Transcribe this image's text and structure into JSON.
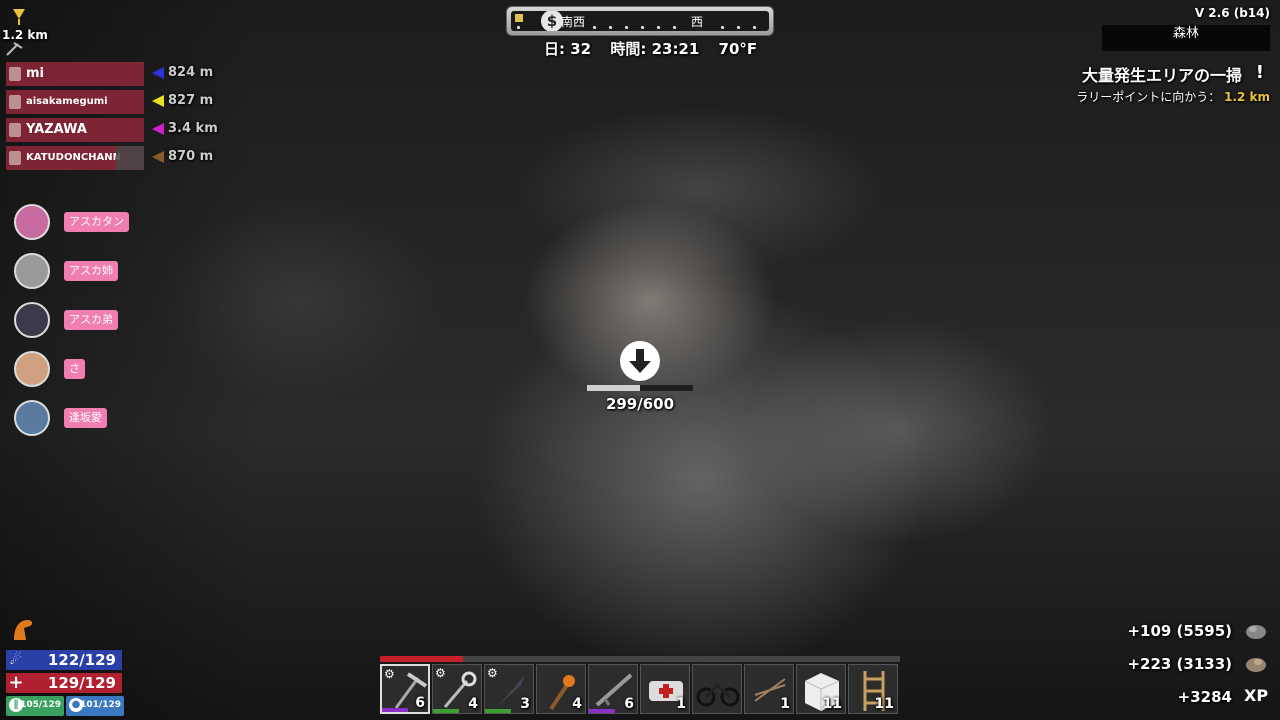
{
  "compass": {
    "labels": [
      "南西",
      "西"
    ],
    "icon": "dollar-icon"
  },
  "time": {
    "day": "日: 32",
    "clock": "時間: 23:21",
    "temp": "70°F"
  },
  "version": "V 2.6 (b14)",
  "biome": "森林",
  "quest": {
    "title": "大量発生エリアの一掃",
    "sub_label": "ラリーポイントに向かう：",
    "sub_dist": "1.2 km"
  },
  "top_left": {
    "distance": "1.2 km"
  },
  "players": [
    {
      "name": "mi",
      "distance": "824 m",
      "color": "#3030e0"
    },
    {
      "name": "aisakamegumi",
      "distance": "827 m",
      "color": "#e8e020"
    },
    {
      "name": "YAZAWA",
      "distance": "3.4 km",
      "color": "#d020d0"
    },
    {
      "name": "KATUDONCHANN",
      "distance": "870 m",
      "color": "#8a5a2a"
    }
  ],
  "party": [
    {
      "tag": "アスカタン",
      "avatar_color": "#c86aa0"
    },
    {
      "tag": "アスカ姉",
      "avatar_color": "#9a9a9a"
    },
    {
      "tag": "アスカ弟",
      "avatar_color": "#3a3a4a"
    },
    {
      "tag": "さ",
      "avatar_color": "#d0a080"
    },
    {
      "tag": "逢坂愛",
      "avatar_color": "#5a7aa0"
    }
  ],
  "target": {
    "hp": "299/600",
    "hp_fraction": 0.498
  },
  "stats": {
    "stamina": "122/129",
    "health": "129/129",
    "food": "105/129",
    "water": "101/129"
  },
  "xp": [
    {
      "text": "+109 (5595)",
      "icon": "stone-icon"
    },
    {
      "text": "+223 (3133)",
      "icon": "ore-icon"
    },
    {
      "text": "+3284",
      "icon": "xp-icon"
    }
  ],
  "toolbelt": {
    "durability_fraction": 0.16,
    "slots": [
      {
        "name": "pickaxe",
        "count": "6",
        "quality_color": "#8a2fc8",
        "mod": true
      },
      {
        "name": "wrench",
        "count": "4",
        "quality_color": "#3aa030",
        "mod": true
      },
      {
        "name": "knife",
        "count": "3",
        "quality_color": "#3aa030",
        "mod": true
      },
      {
        "name": "torch",
        "count": "4",
        "quality_color": "",
        "mod": false
      },
      {
        "name": "rifle",
        "count": "6",
        "quality_color": "#8a2fc8",
        "mod": false
      },
      {
        "name": "medkit",
        "count": "1",
        "quality_color": "",
        "mod": false
      },
      {
        "name": "motorcycle",
        "count": "",
        "quality_color": "",
        "mod": false
      },
      {
        "name": "arrows",
        "count": "1",
        "quality_color": "",
        "mod": false
      },
      {
        "name": "block",
        "count": "11",
        "quality_color": "",
        "mod": false
      },
      {
        "name": "ladder",
        "count": "11",
        "quality_color": "",
        "mod": false
      }
    ]
  }
}
